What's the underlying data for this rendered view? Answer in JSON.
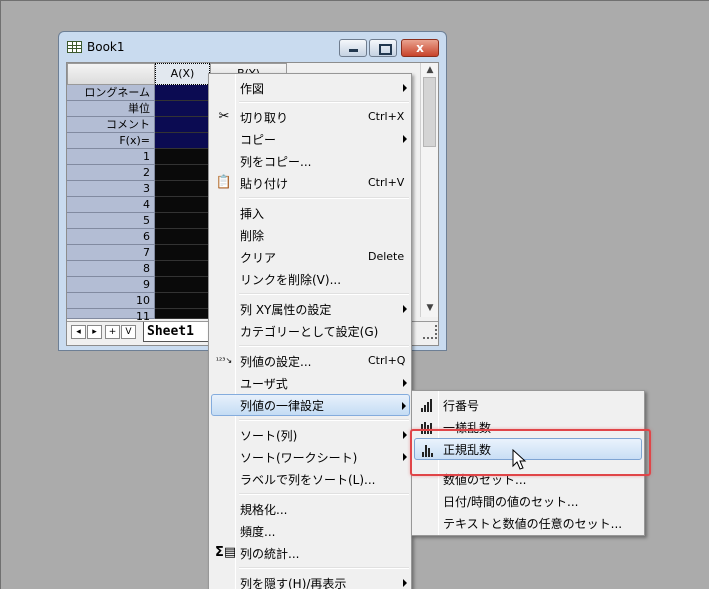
{
  "colors": {
    "highlight_box": "#e04548",
    "meta_cells": "#0b0b52",
    "data_cells": "#0a0a0a",
    "row_labels": "#b3bdd4"
  },
  "book": {
    "title": "Book1",
    "close_glyph": "x",
    "columns": [
      "A(X)",
      "B(Y)"
    ],
    "meta_rows": [
      "ロングネーム",
      "単位",
      "コメント",
      "F(x)="
    ],
    "data_rows": [
      "1",
      "2",
      "3",
      "4",
      "5",
      "6",
      "7",
      "8",
      "9",
      "10",
      "11"
    ],
    "sheet_tab": "Sheet1",
    "nav_buttons": [
      "◂",
      "▸",
      "+",
      "V"
    ]
  },
  "main_menu": {
    "plot": "作図",
    "cut": "切り取り",
    "cut_shortcut": "Ctrl+X",
    "copy": "コピー",
    "copy_column": "列をコピー...",
    "paste": "貼り付け",
    "paste_shortcut": "Ctrl+V",
    "insert": "挿入",
    "delete": "削除",
    "clear": "クリア",
    "clear_shortcut": "Delete",
    "remove_links": "リンクを削除(V)...",
    "set_xy": "列 XY属性の設定",
    "set_categorical": "カテゴリーとして設定(G)",
    "set_values": "列値の設定...",
    "set_values_shortcut": "Ctrl+Q",
    "user_defined": "ユーザ式",
    "fill_column": "列値の一律設定",
    "sort_column": "ソート(列)",
    "sort_worksheet": "ソート(ワークシート)",
    "sort_by_label": "ラベルで列をソート(L)...",
    "normalize": "規格化...",
    "frequency": "頻度...",
    "statistics": "列の統計...",
    "hide_show": "列を隠す(H)/再表示"
  },
  "sub_menu": {
    "row_numbers": "行番号",
    "uniform_random": "一様乱数",
    "normal_random": "正規乱数",
    "set_values": "数値のセット...",
    "set_datetime": "日付/時間の値のセット...",
    "set_text_numeric": "テキストと数値の任意のセット..."
  }
}
